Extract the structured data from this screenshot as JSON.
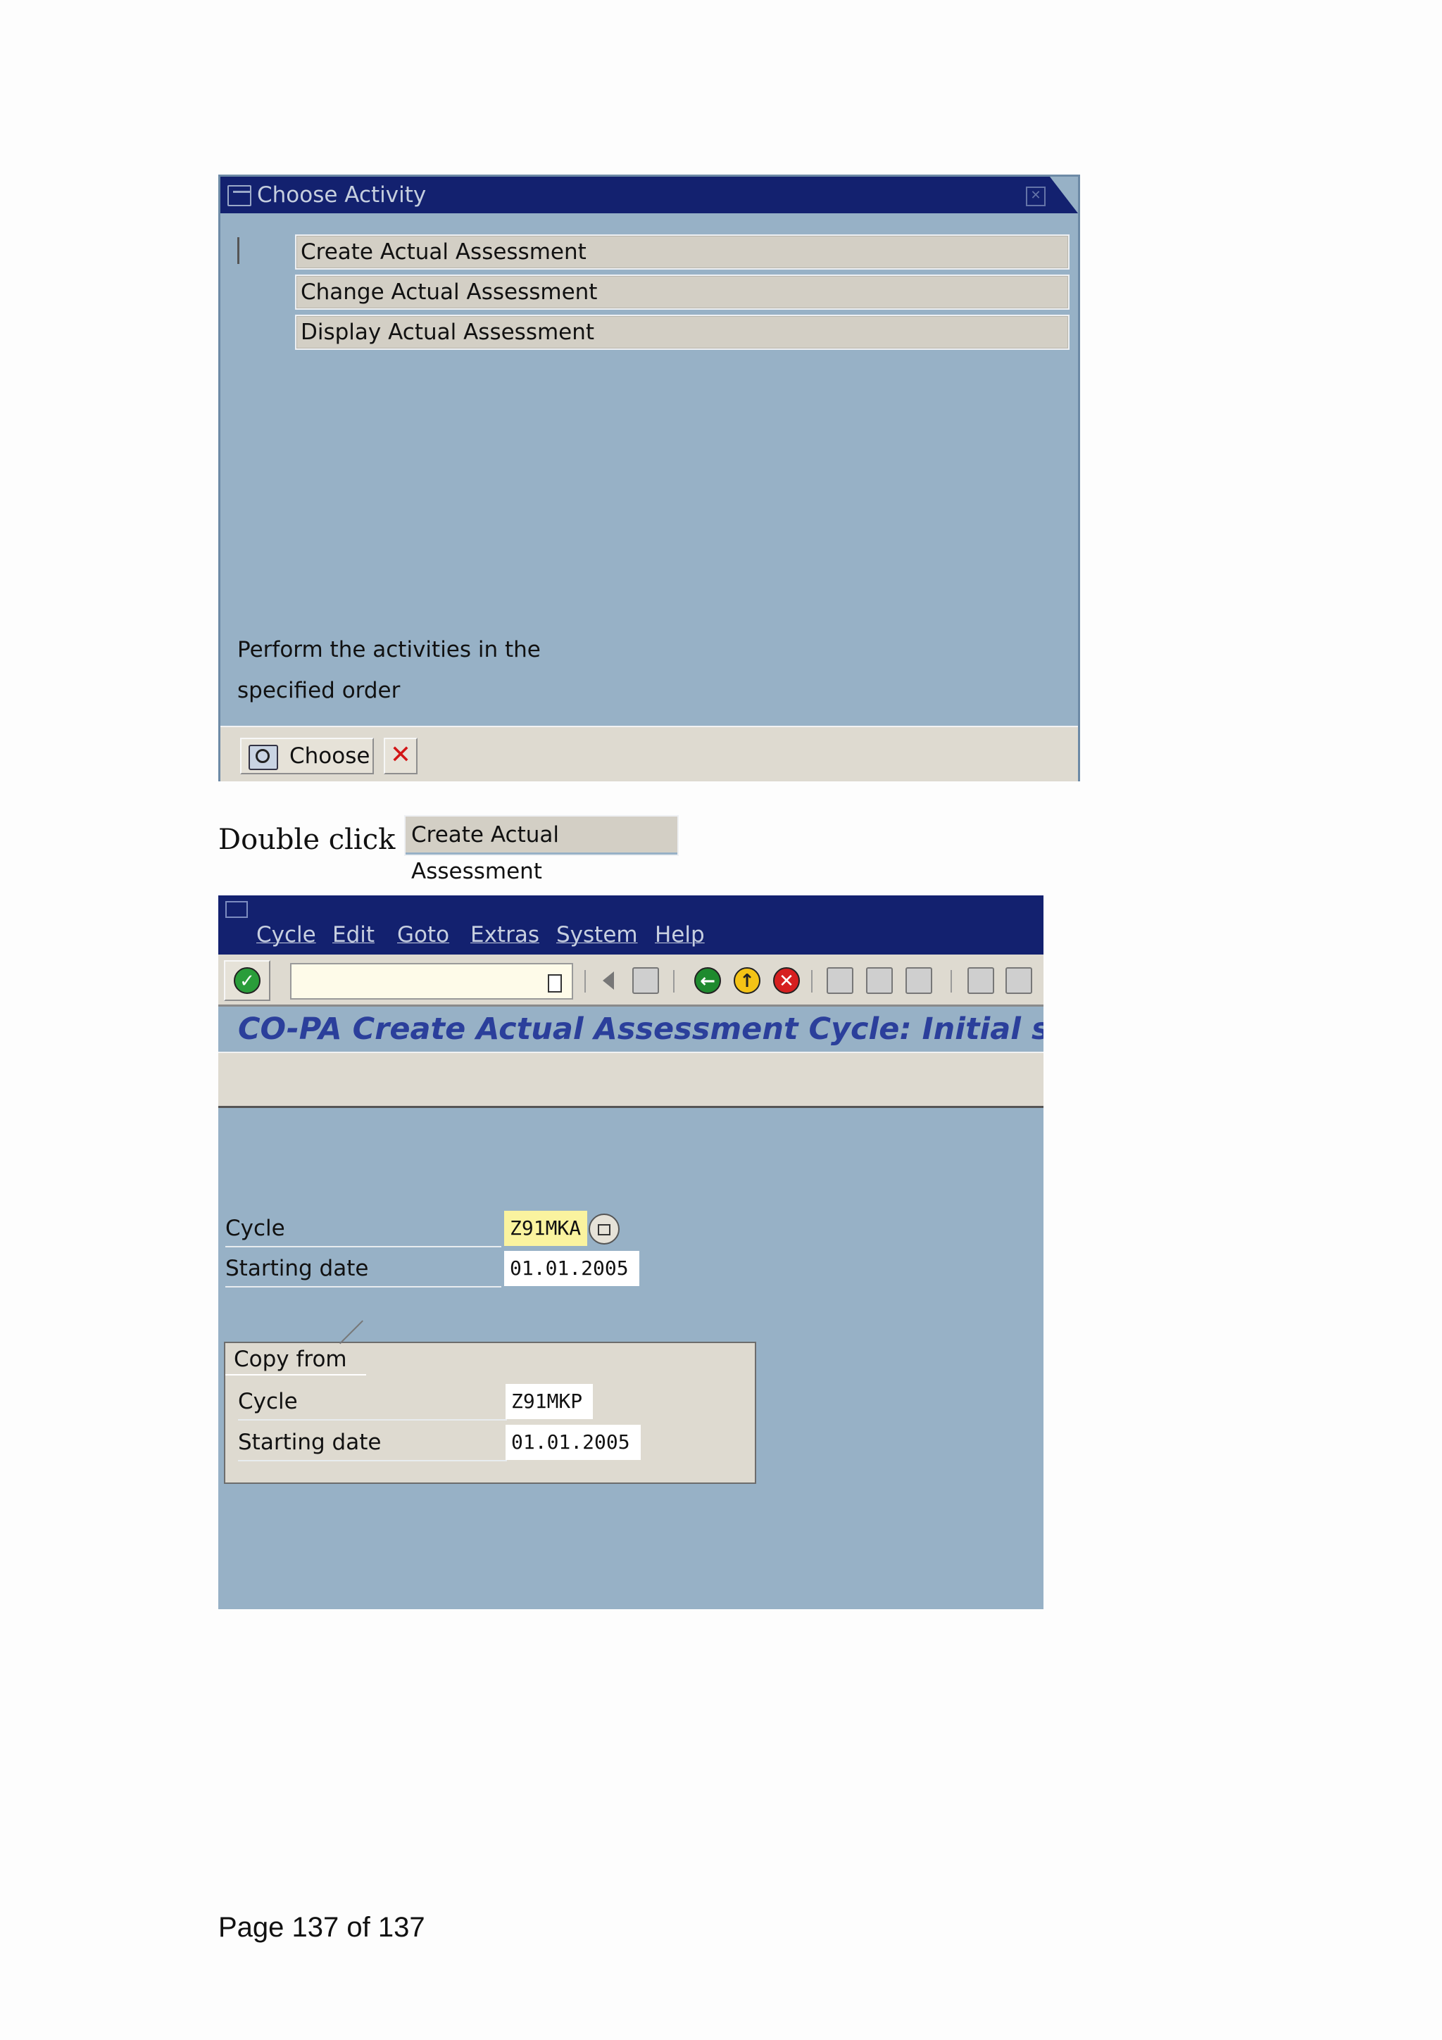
{
  "dialog": {
    "title": "Choose Activity",
    "activities": [
      "Create Actual Assessment",
      "Change Actual Assessment",
      "Display Actual Assessment"
    ],
    "hint_line1": "Perform the activities in the",
    "hint_line2": "specified order",
    "choose_label": "Choose"
  },
  "instruction": {
    "text": "Double click",
    "snippet": "Create Actual Assessment"
  },
  "sap": {
    "menu": [
      "Cycle",
      "Edit",
      "Goto",
      "Extras",
      "System",
      "Help"
    ],
    "toolbar_icons": [
      "enter-icon",
      "command-field",
      "previous-icon",
      "save-icon",
      "back-icon",
      "exit-icon",
      "cancel-icon",
      "print-icon",
      "find-icon",
      "find-next-icon",
      "first-page-icon",
      "previous-page-icon"
    ],
    "title": "CO-PA Create Actual Assessment Cycle: Initial scree",
    "fields": {
      "cycle_label": "Cycle",
      "cycle_value": "Z91MKA",
      "start_label": "Starting date",
      "start_value": "01.01.2005"
    },
    "copy_from": {
      "title": "Copy from",
      "cycle_label": "Cycle",
      "cycle_value": "Z91MKP",
      "start_label": "Starting date",
      "start_value": "01.01.2005"
    },
    "colors": {
      "title_bar": "#13216f",
      "background": "#97b1c6",
      "panel": "#dedad0",
      "required_field": "#faf39f",
      "screen_title": "#2b3f9b"
    }
  },
  "footer": {
    "page": "Page 137 of 137"
  }
}
